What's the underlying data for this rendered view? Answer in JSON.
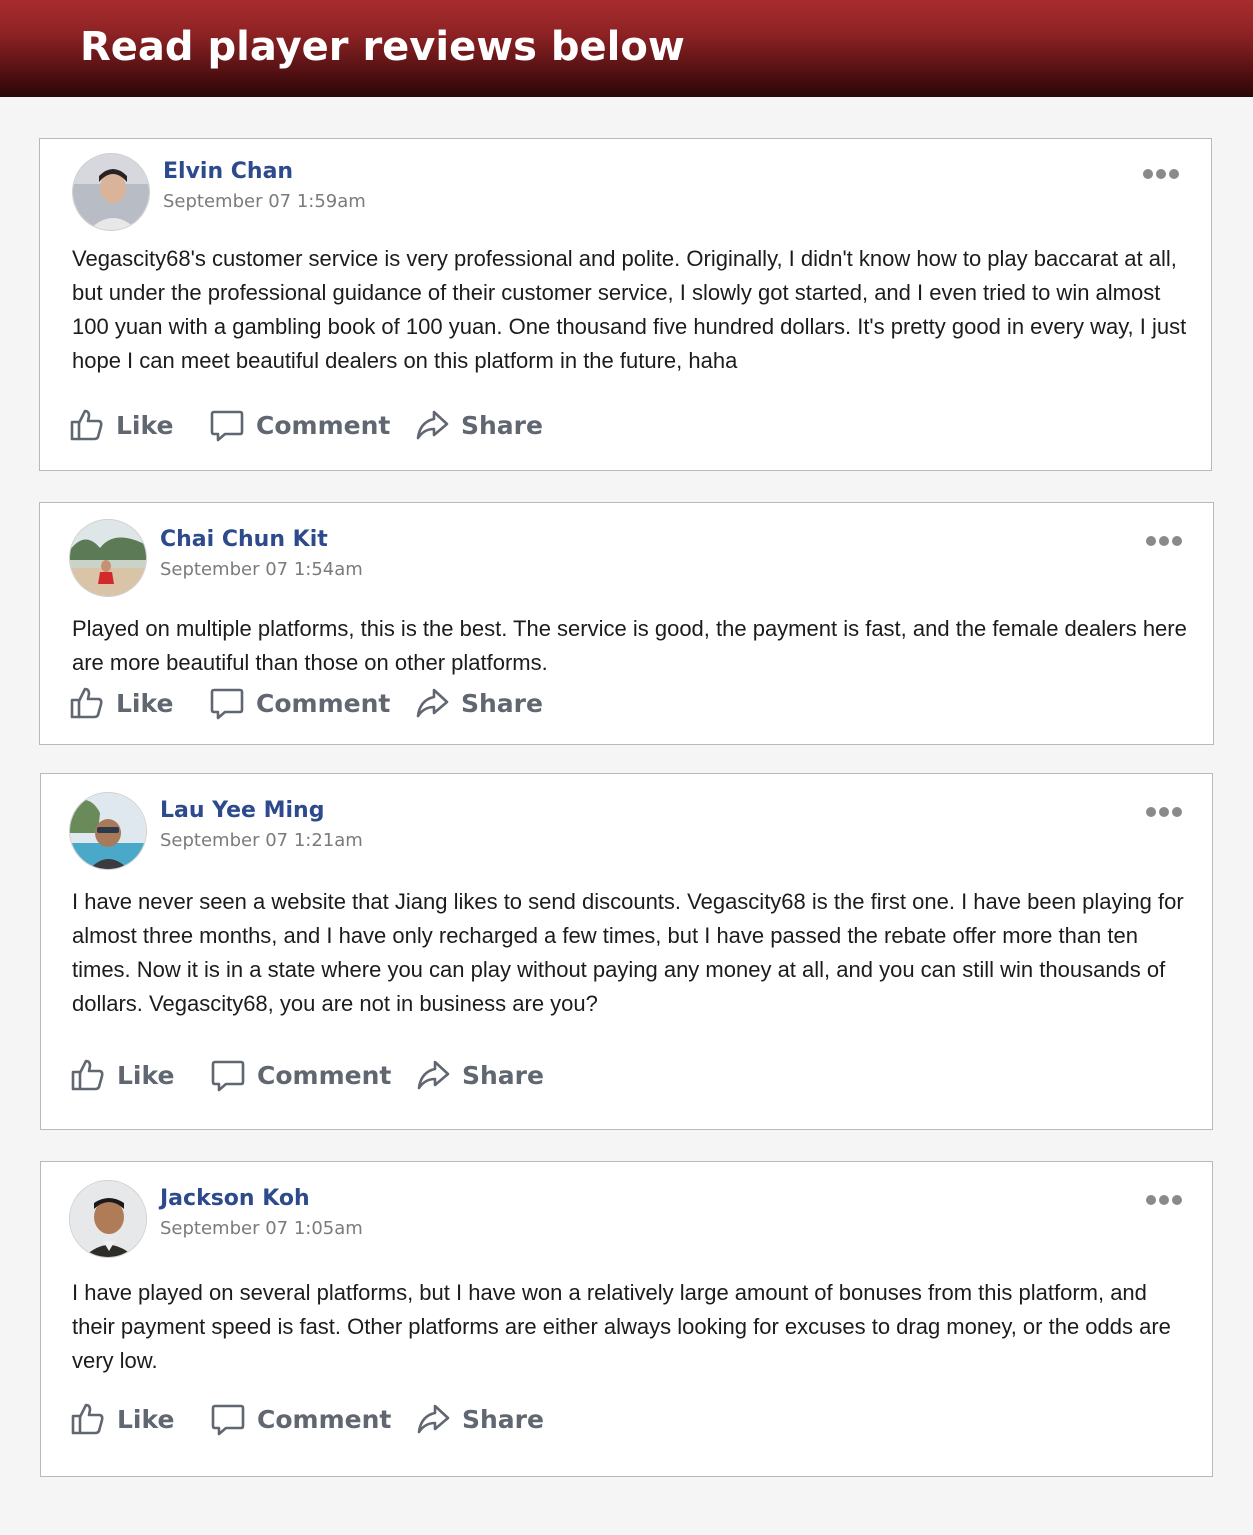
{
  "header": {
    "title": "Read player reviews below"
  },
  "actions": {
    "like": "Like",
    "comment": "Comment",
    "share": "Share"
  },
  "icons": {
    "like": "thumbs-up-icon",
    "comment": "comment-bubble-icon",
    "share": "share-arrow-icon",
    "more": "more-options-icon"
  },
  "colors": {
    "banner": "#8e2224",
    "name": "#2d4a8c",
    "date": "#7b7b7b",
    "action": "#606770"
  },
  "reviews": [
    {
      "name": "Elvin Chan",
      "date": "September 07 1:59am",
      "text": "Vegascity68's customer service is very professional and polite. Originally, I didn't know how to play baccarat at all, but under the professional guidance of their customer service, I slowly got started, and I even tried to win almost 100 yuan with a gambling book of 100 yuan. One thousand five hundred dollars. It's pretty good in every way, I just hope I can meet beautiful dealers on this platform in the future, haha"
    },
    {
      "name": "Chai Chun Kit",
      "date": "September 07 1:54am",
      "text": "Played on multiple platforms, this is the best. The service is good, the payment is fast, and the female dealers here are more beautiful than those on other platforms."
    },
    {
      "name": "Lau Yee Ming",
      "date": "September 07 1:21am",
      "text": "I have never seen a website that Jiang likes to send discounts. Vegascity68 is the first one. I have been playing for almost three months, and I have only recharged a few times, but I have passed the rebate offer more than ten times. Now it is in a state where you can play without paying any money at all, and you can still win thousands of dollars. Vegascity68, you are not in business are you?"
    },
    {
      "name": "Jackson Koh",
      "date": "September 07 1:05am",
      "text": "I have played on several platforms, but I have won a relatively large amount of bonuses from this platform, and their payment speed is fast. Other platforms are either always looking for excuses to drag money, or the odds are very low."
    }
  ]
}
